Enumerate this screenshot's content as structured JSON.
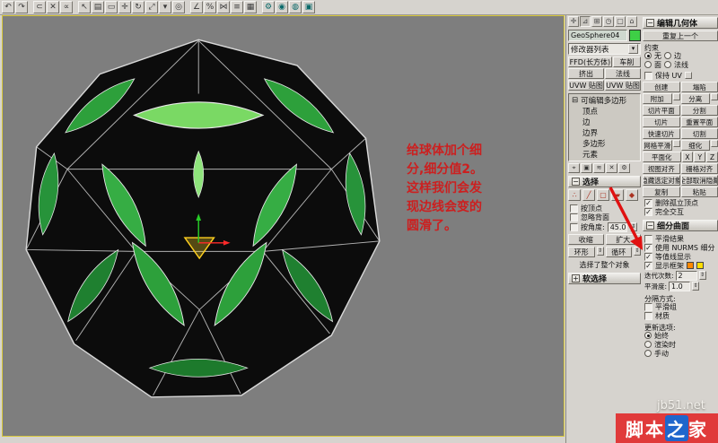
{
  "toolbar": {
    "icons": [
      {
        "g": "↶"
      },
      {
        "g": "↷"
      },
      {
        "g": "⊂"
      },
      {
        "g": "✕"
      },
      {
        "g": "∝"
      },
      {
        "g": "↖"
      },
      {
        "g": "▤"
      },
      {
        "g": "▭"
      },
      {
        "g": "✛"
      },
      {
        "g": "↻"
      },
      {
        "g": "⤢"
      },
      {
        "g": "▾"
      },
      {
        "g": "◎"
      },
      {
        "g": "∠"
      },
      {
        "g": "%"
      },
      {
        "g": "⋈"
      },
      {
        "g": "≡"
      },
      {
        "g": "▦"
      },
      {
        "g": "⚙"
      },
      {
        "g": "◉"
      },
      {
        "g": "◍"
      },
      {
        "g": "▣"
      }
    ],
    "tabs": [
      {
        "g": "✛"
      },
      {
        "g": "⊿"
      },
      {
        "g": "⊞"
      },
      {
        "g": "◷"
      },
      {
        "g": "▢"
      },
      {
        "g": "⌂"
      }
    ]
  },
  "annotation": {
    "lines": [
      "给球体加个细",
      "分,细分值2。",
      "这样我们会发",
      "现边线会变的",
      "圆滑了。"
    ]
  },
  "panel": {
    "object_name": "GeoSphere04",
    "modifier_list": "修改器列表",
    "mod_buttons": {
      "r1l": "FFD(长方体)",
      "r1r": "车削",
      "r2l": "挤出",
      "r2r": "法线",
      "r3l": "UVW 贴图",
      "r3r": "UVW 贴图"
    },
    "stack": {
      "expand": "⊟",
      "root": "可编辑多边形",
      "items": [
        "顶点",
        "边",
        "边界",
        "多边形",
        "元素"
      ]
    },
    "selection": {
      "title": "选择",
      "by_vertex": "按顶点",
      "ignore_backfacing": "忽略背面",
      "by_angle": "按角度:",
      "angle_value": "45.0",
      "shrink": "收缩",
      "grow": "扩大",
      "ring": "环形",
      "loop": "循环",
      "status": "选择了整个对象"
    },
    "soft_selection": {
      "title": "软选择"
    },
    "edit_geometry": {
      "title": "编辑几何体",
      "repeat_last": "重复上一个",
      "constraints": "约束",
      "c_none": "无",
      "c_edge": "边",
      "c_face": "面",
      "c_normal": "法线",
      "preserve_uv": "保持 UV",
      "rows1": [
        [
          "创建",
          "塌陷"
        ],
        [
          "附加",
          "分离"
        ],
        [
          "切片平面",
          "分割"
        ],
        [
          "切片",
          "重置平面"
        ],
        [
          "快速切片",
          "切割"
        ],
        [
          "网格平滑",
          "细化"
        ]
      ],
      "planarize": "平面化",
      "ax_x": "X",
      "ax_y": "Y",
      "ax_z": "Z",
      "rows2": [
        [
          "视图对齐",
          "栅格对齐"
        ],
        [
          "隐藏选定对象",
          "全部取消隐藏"
        ],
        [
          "复制",
          "粘贴"
        ]
      ],
      "delete_isolated": "删除孤立顶点",
      "full_interactivity": "完全交互"
    },
    "subdivision": {
      "title": "细分曲面",
      "smooth_result": "平滑结果",
      "use_nurms": "使用 NURMS 细分",
      "isoline": "等值线显示",
      "show_cage": "显示框架",
      "iterations_label": "迭代次数:",
      "iterations_value": "2",
      "smoothness_label": "平滑度:",
      "smoothness_value": "1.0",
      "separate_label": "分隔方式:",
      "smoothing_groups": "平滑组",
      "materials": "材质",
      "update_label": "更新选项:",
      "update_always": "始终",
      "update_render": "渲染时",
      "update_manual": "手动"
    },
    "colors": {
      "object_swatch": "#3ecf46",
      "cage_orange": "#ff8800",
      "cage_yellow": "#ffdd00"
    }
  },
  "watermark": {
    "site": "jb51.net",
    "badge_pre": "脚本",
    "badge_mid": "之",
    "badge_post": "家"
  }
}
